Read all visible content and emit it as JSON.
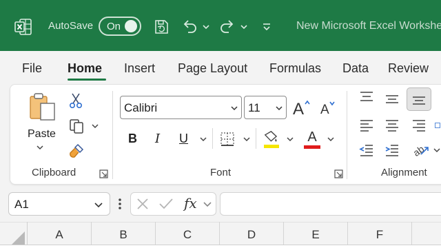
{
  "titlebar": {
    "autosave_label": "AutoSave",
    "autosave_state": "On",
    "document_title": "New Microsoft Excel Worksheet",
    "bg_color": "#1e7a45"
  },
  "tabs": [
    {
      "label": "File"
    },
    {
      "label": "Home",
      "active": true
    },
    {
      "label": "Insert"
    },
    {
      "label": "Page Layout"
    },
    {
      "label": "Formulas"
    },
    {
      "label": "Data"
    },
    {
      "label": "Review"
    }
  ],
  "ribbon": {
    "clipboard": {
      "paste_label": "Paste",
      "group_label": "Clipboard"
    },
    "font": {
      "font_name": "Calibri",
      "font_size": "11",
      "bold": "B",
      "italic": "I",
      "underline": "U",
      "font_color_glyph": "A",
      "highlight_color": "#f5e600",
      "font_color": "#e01b1b",
      "group_label": "Font"
    },
    "alignment": {
      "group_label": "Alignment"
    }
  },
  "formula_bar": {
    "name_box": "A1",
    "fx_label": "fx",
    "formula_value": ""
  },
  "columns": [
    "A",
    "B",
    "C",
    "D",
    "E",
    "F"
  ]
}
